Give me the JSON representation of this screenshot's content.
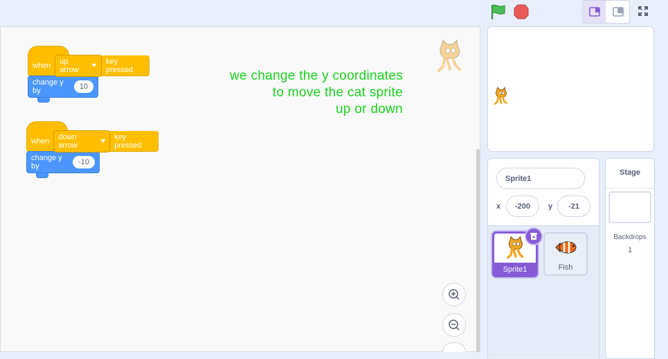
{
  "topbar": {
    "green_flag_color": "#4cbf56",
    "stop_color": "#ec5959"
  },
  "code": {
    "script1": {
      "when": "when",
      "key": "up arrow",
      "suffix": "key pressed",
      "change_label": "change y by",
      "value": "10"
    },
    "script2": {
      "when": "when",
      "key": "down arrow",
      "suffix": "key pressed",
      "change_label": "change y by",
      "value": "-10"
    },
    "comment": [
      "we change the y coordinates",
      "to move the cat sprite",
      "up or down"
    ]
  },
  "sprite_info": {
    "name": "Sprite1",
    "x_label": "x",
    "x_value": "-200",
    "y_label": "y",
    "y_value": "-21"
  },
  "sprites": [
    {
      "label": "Sprite1",
      "icon": "cat-sprite-icon",
      "selected": true
    },
    {
      "label": "Fish",
      "icon": "fish-sprite-icon",
      "selected": false
    }
  ],
  "stage_pane": {
    "title": "Stage",
    "backdrops_label": "Backdrops",
    "backdrops_count": "1"
  },
  "colors": {
    "accent": "#855cd6",
    "events": "#ffbf00",
    "motion": "#4c97ff",
    "comment": "#18d21e"
  }
}
